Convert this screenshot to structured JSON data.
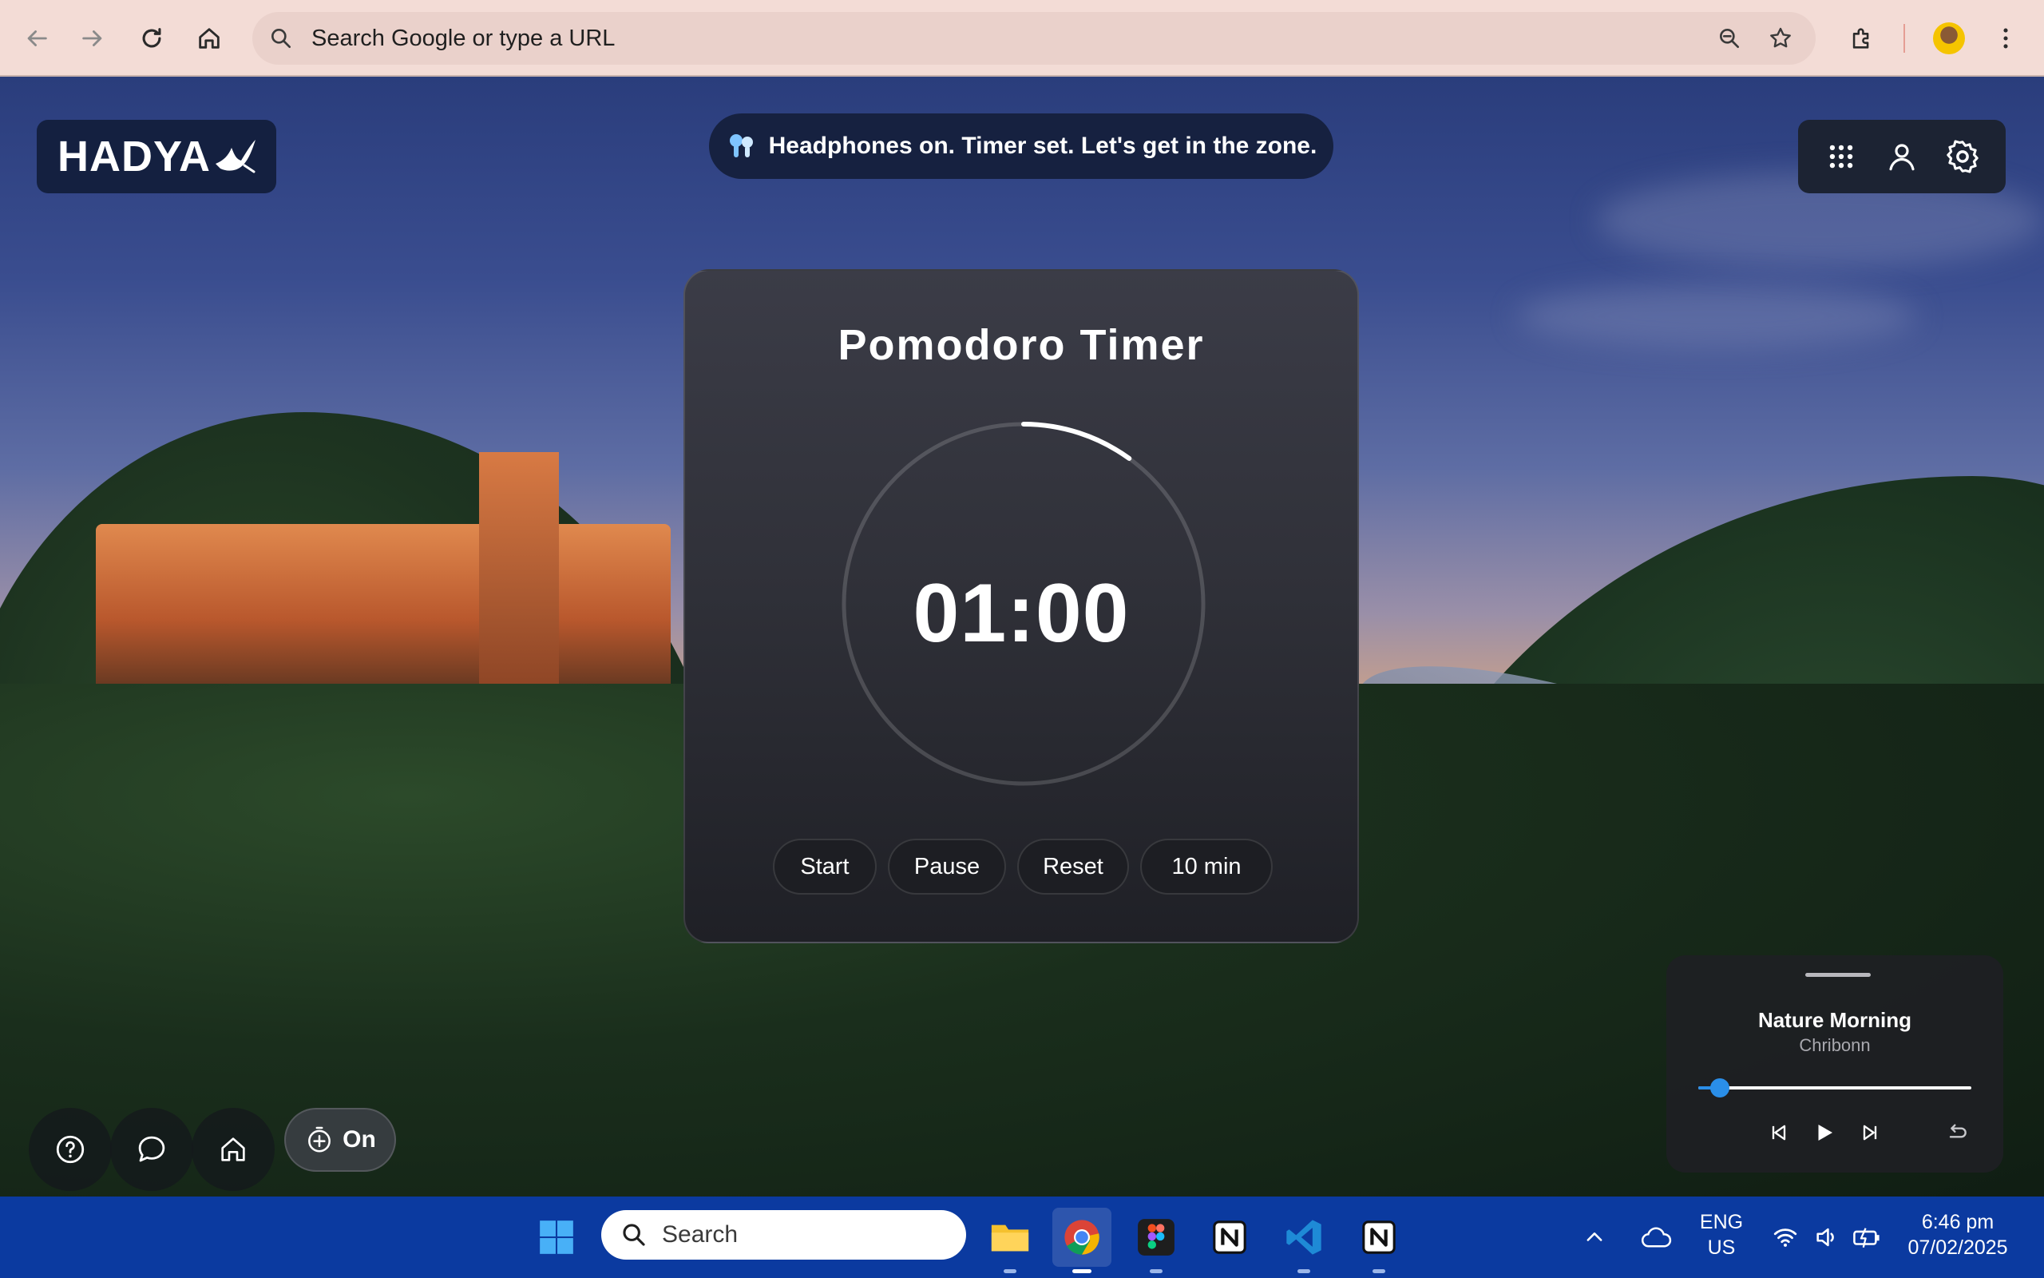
{
  "browser": {
    "omnibox_placeholder": "Search Google or type a URL"
  },
  "app": {
    "logo_text": "HADYA",
    "toast": "Headphones on. Timer set. Let's get in the zone."
  },
  "pomodoro": {
    "title": "Pomodoro Timer",
    "time": "01:00",
    "progress_fraction": 0.1,
    "buttons": {
      "start": "Start",
      "pause": "Pause",
      "reset": "Reset",
      "duration": "10 min"
    }
  },
  "bottom_controls": {
    "timer_toggle_label": "On"
  },
  "player": {
    "title": "Nature Morning",
    "artist": "Chribonn",
    "progress_fraction": 0.08
  },
  "taskbar": {
    "search_placeholder": "Search",
    "language": "ENG",
    "region": "US",
    "time": "6:46 pm",
    "date": "07/02/2025"
  },
  "colors": {
    "accent_blue": "#2a8ee8",
    "taskbar": "#0b3aa0",
    "chrome": "#f3dcd6"
  }
}
